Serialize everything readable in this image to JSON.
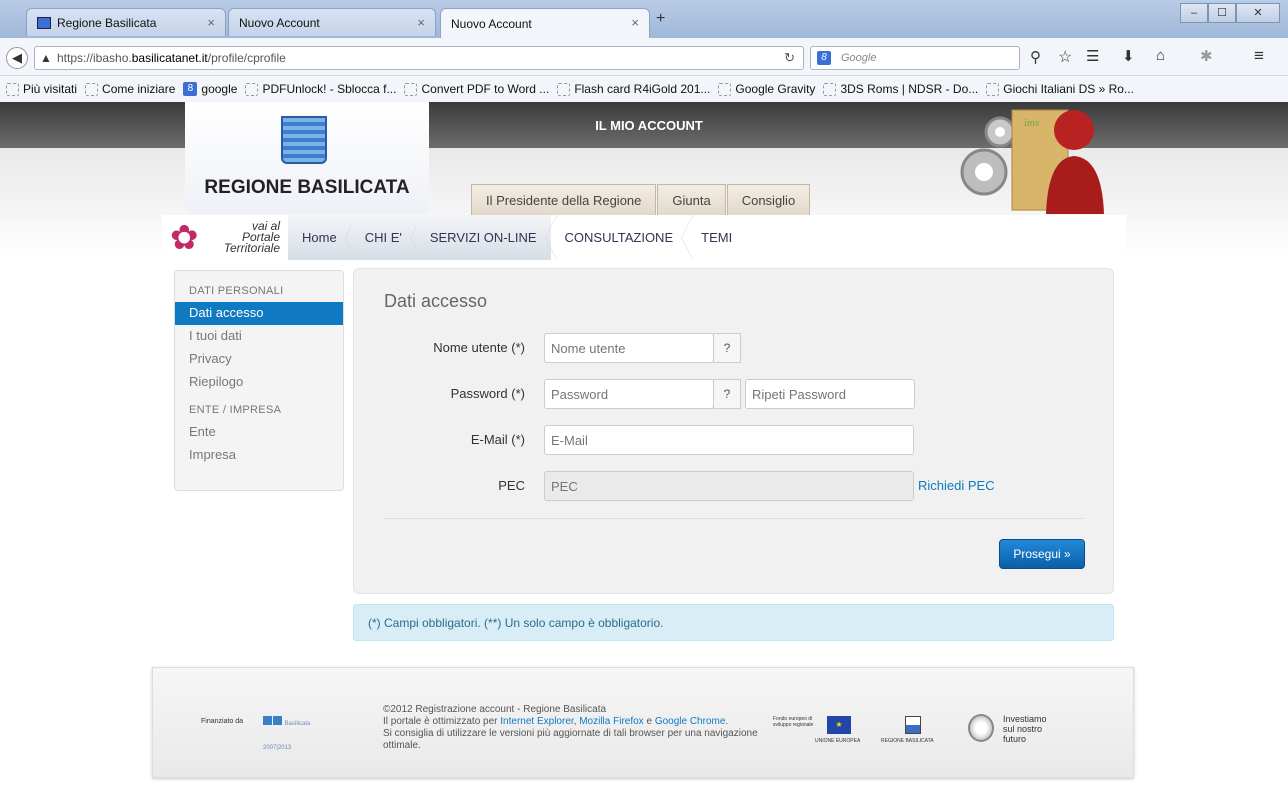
{
  "browser": {
    "tabs": [
      {
        "label": "Regione Basilicata",
        "close": "×"
      },
      {
        "label": "Nuovo Account",
        "close": "×"
      },
      {
        "label": "Nuovo Account",
        "close": "×"
      }
    ],
    "new_tab": "+",
    "window_controls": [
      "–",
      "☐",
      "✕"
    ],
    "url_prefix": "https://ibasho.",
    "url_domain": "basilicatanet.it",
    "url_path": "/profile/cprofile",
    "search_placeholder": "Google",
    "bookmarks": [
      {
        "label": "Più visitati"
      },
      {
        "label": "Come iniziare"
      },
      {
        "label": "google"
      },
      {
        "label": "PDFUnlock! - Sblocca f..."
      },
      {
        "label": "Convert PDF to Word ..."
      },
      {
        "label": "Flash card R4iGold 201..."
      },
      {
        "label": "Google Gravity"
      },
      {
        "label": "3DS Roms | NDSR - Do..."
      },
      {
        "label": "Giochi Italiani DS » Ro..."
      }
    ]
  },
  "header": {
    "logo_text": "REGIONE BASILICATA",
    "account_title": "IL MIO ACCOUNT",
    "top_tabs": [
      "Il Presidente della Regione",
      "Giunta",
      "Consiglio"
    ],
    "portal_text": [
      "vai al",
      "Portale",
      "Territoriale"
    ],
    "menu": [
      "Home",
      "CHI E'",
      "SERVIZI ON-LINE",
      "CONSULTAZIONE",
      "TEMI"
    ]
  },
  "sidebar": {
    "section1": "DATI PERSONALI",
    "items1": [
      "Dati accesso",
      "I tuoi dati",
      "Privacy",
      "Riepilogo"
    ],
    "section2": "ENTE / IMPRESA",
    "items2": [
      "Ente",
      "Impresa"
    ]
  },
  "form": {
    "title": "Dati accesso",
    "username_label": "Nome utente (*)",
    "username_placeholder": "Nome utente",
    "password_label": "Password (*)",
    "password_placeholder": "Password",
    "repeat_password_placeholder": "Ripeti Password",
    "email_label": "E-Mail (*)",
    "email_placeholder": "E-Mail",
    "pec_label": "PEC",
    "pec_placeholder": "PEC",
    "pec_link": "Richiedi PEC",
    "help": "?",
    "submit": "Prosegui »"
  },
  "note": "(*) Campi obbligatori. (**) Un solo campo è obbligatorio.",
  "footer": {
    "financed_by": "Finanziato da",
    "fesr": "Basilicata 2007|2013",
    "line1": "©2012 Registrazione account - Regione Basilicata",
    "line2_a": "Il portale è ottimizzato per ",
    "link_ie": "Internet Explorer",
    "link_ff": "Mozilla Firefox",
    "and": " e ",
    "link_gc": "Google Chrome",
    "line3": "Si consiglia di utilizzare le versioni più aggiornate di tali browser per una navigazione ottimale.",
    "eu_fund": "Fondo europeo di sviluppo regionale",
    "eu": "UNIONE EUROPEA",
    "rb": "REGIONE BASILICATA",
    "invest": [
      "Investiamo",
      "sul nostro",
      "futuro"
    ]
  }
}
